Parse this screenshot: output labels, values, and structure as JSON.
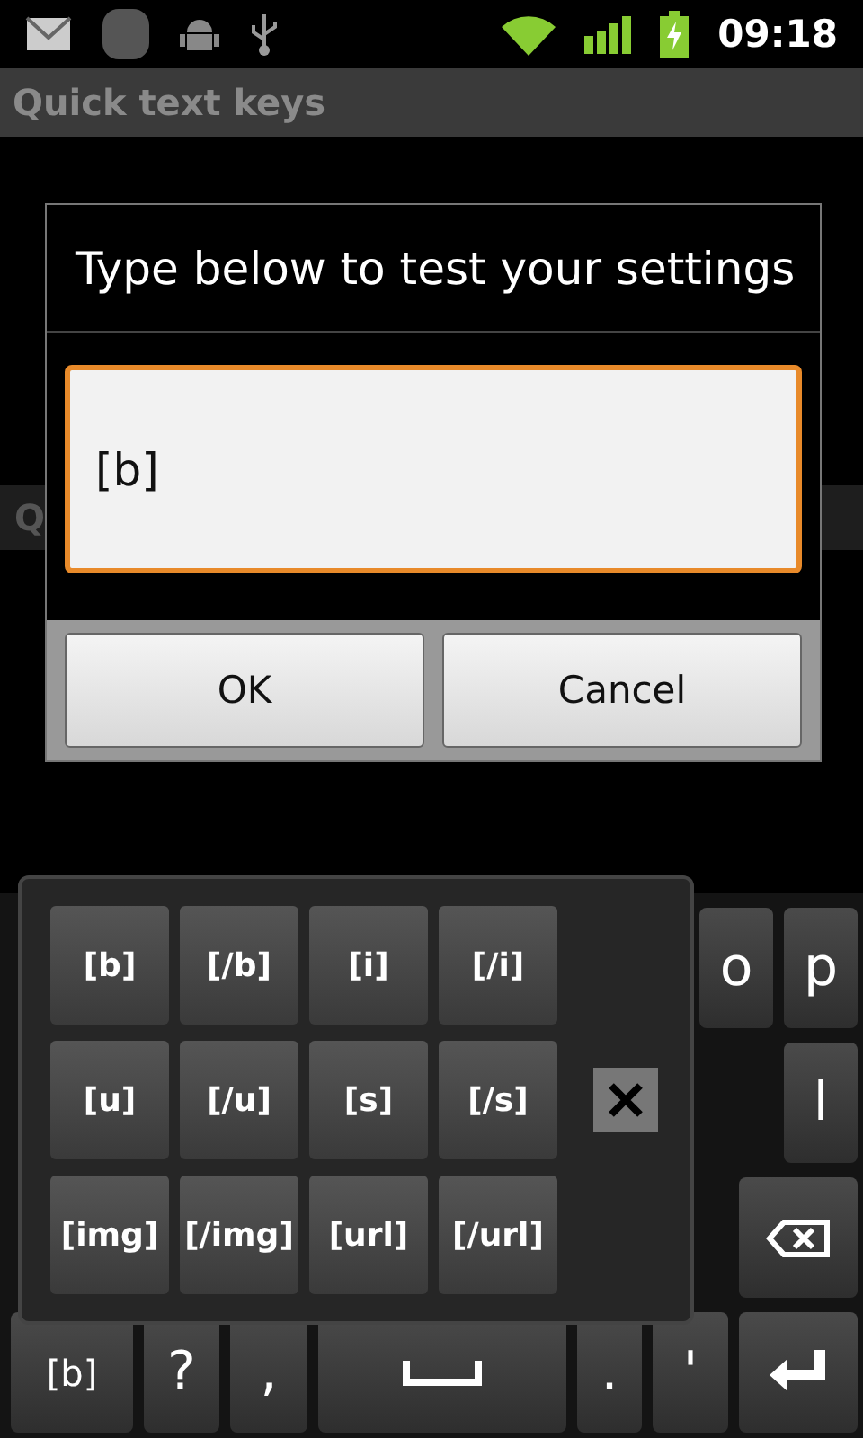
{
  "status_bar": {
    "time": "09:18"
  },
  "title_bar": {
    "title": "Quick text keys"
  },
  "category": {
    "label": "Q"
  },
  "dialog": {
    "title": "Type below to test your settings",
    "input": {
      "value": "[b]",
      "focused": true
    },
    "buttons": [
      "OK",
      "Cancel"
    ]
  },
  "keyboard": {
    "rows": [
      {
        "keys": [
          {
            "kind": "char",
            "label": "o"
          },
          {
            "kind": "char",
            "label": "p"
          }
        ]
      },
      {
        "keys": [
          {
            "kind": "char",
            "label": "l"
          }
        ]
      },
      {
        "keys": [
          {
            "kind": "backspace"
          }
        ]
      },
      {
        "keys": [
          {
            "kind": "char",
            "label": "[b]"
          },
          {
            "kind": "char",
            "label": "?"
          },
          {
            "kind": "char",
            "label": ","
          },
          {
            "kind": "space"
          },
          {
            "kind": "char",
            "label": "."
          },
          {
            "kind": "char",
            "label": "'"
          },
          {
            "kind": "enter"
          }
        ]
      }
    ]
  },
  "quick_text_popup": {
    "rows": [
      [
        "[b]",
        "[/b]",
        "[i]",
        "[/i]"
      ],
      [
        "[u]",
        "[/u]",
        "[s]",
        "[/s]"
      ],
      [
        "[img]",
        "[/img]",
        "[url]",
        "[/url]"
      ]
    ]
  }
}
